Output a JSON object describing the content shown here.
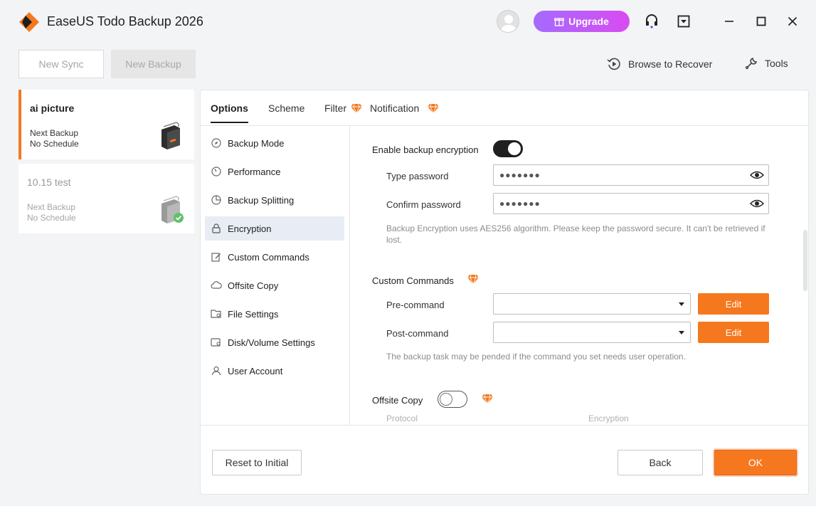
{
  "app": {
    "title": "EaseUS Todo Backup 2026"
  },
  "header": {
    "upgrade_label": "Upgrade"
  },
  "toolbar": {
    "new_sync": "New Sync",
    "new_backup": "New Backup",
    "browse_to_recover": "Browse to Recover",
    "tools": "Tools"
  },
  "tasks": [
    {
      "name": "ai picture",
      "line1": "Next Backup",
      "line2": "No Schedule"
    },
    {
      "name": "10.15 test",
      "line1": "Next Backup",
      "line2": "No Schedule"
    }
  ],
  "tabs": {
    "options": "Options",
    "scheme": "Scheme",
    "filter": "Filter",
    "notification": "Notification"
  },
  "nav": [
    {
      "label": "Backup Mode",
      "icon": "compass-icon"
    },
    {
      "label": "Performance",
      "icon": "gauge-icon"
    },
    {
      "label": "Backup Splitting",
      "icon": "pie-chart-icon"
    },
    {
      "label": "Encryption",
      "icon": "lock-icon"
    },
    {
      "label": "Custom Commands",
      "icon": "edit-icon"
    },
    {
      "label": "Offsite Copy",
      "icon": "cloud-icon"
    },
    {
      "label": "File Settings",
      "icon": "folder-gear-icon"
    },
    {
      "label": "Disk/Volume Settings",
      "icon": "disk-gear-icon"
    },
    {
      "label": "User Account",
      "icon": "user-icon"
    }
  ],
  "encryption": {
    "enable_label": "Enable backup encryption",
    "enabled": true,
    "type_label": "Type password",
    "type_value": "●●●●●●●",
    "confirm_label": "Confirm password",
    "confirm_value": "●●●●●●●",
    "hint": "Backup Encryption uses AES256 algorithm. Please keep the password secure. It can't be retrieved if lost."
  },
  "custom_commands": {
    "title": "Custom Commands",
    "pre_label": "Pre-command",
    "pre_value": "",
    "post_label": "Post-command",
    "post_value": "",
    "edit_label": "Edit",
    "hint": "The backup task may be pended if the command you set needs user operation."
  },
  "offsite": {
    "title": "Offsite Copy",
    "enabled": false,
    "col_protocol": "Protocol",
    "col_encryption": "Encryption"
  },
  "footer": {
    "reset": "Reset to Initial",
    "back": "Back",
    "ok": "OK"
  },
  "colors": {
    "accent": "#f5781f",
    "upgrade_start": "#a46bff",
    "upgrade_end": "#d94bf0"
  }
}
